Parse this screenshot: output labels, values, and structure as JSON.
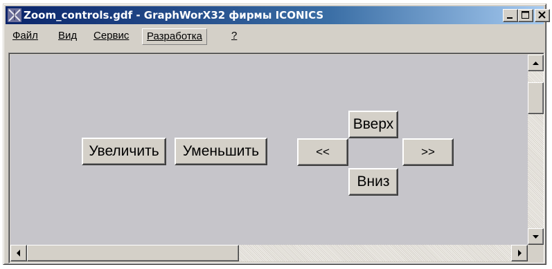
{
  "window": {
    "title": "Zoom_controls.gdf - GraphWorX32 фирмы ICONICS",
    "icon": "graphworx-app-icon",
    "controls": [
      "minimize-icon",
      "maximize-icon",
      "close-icon"
    ]
  },
  "menu": {
    "items": [
      {
        "label": "Файл"
      },
      {
        "label": "Вид"
      },
      {
        "label": "Сервис"
      },
      {
        "label": "Разработка",
        "active": true
      },
      {
        "label": "?"
      }
    ]
  },
  "canvas": {
    "zoom_in_label": "Увеличить",
    "zoom_out_label": "Уменьшить",
    "pan_left_label": "<<",
    "pan_right_label": ">>",
    "pan_up_label": "Вверх",
    "pan_down_label": "Вниз",
    "background": "#c6c5ca"
  },
  "scrollbars": {
    "up_icon": "arrow-up-icon",
    "down_icon": "arrow-down-icon",
    "left_icon": "arrow-left-icon",
    "right_icon": "arrow-right-icon"
  }
}
